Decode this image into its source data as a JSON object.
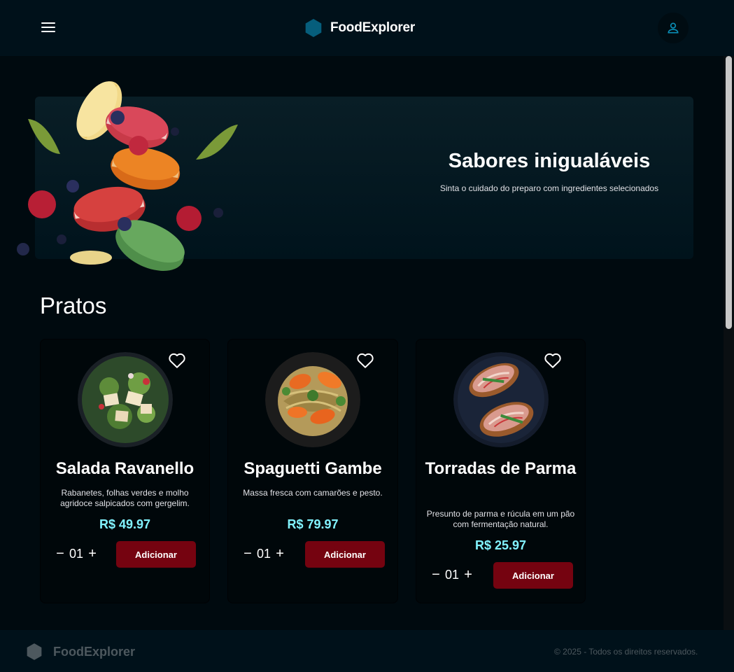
{
  "header": {
    "title": "FoodExplorer",
    "logo_icon": "hexagon-icon",
    "menu_icon": "hamburger-menu-icon",
    "user_icon": "user-icon",
    "accent_color": "#065e7c"
  },
  "banner": {
    "title": "Sabores inigualáveis",
    "subtitle": "Sinta o cuidado do preparo com ingredientes selecionados"
  },
  "section": {
    "title": "Pratos"
  },
  "dishes": [
    {
      "name": "Salada Ravanello",
      "description": "Rabanetes, folhas verdes e molho agridoce salpicados com gergelim.",
      "price": "R$ 49.97",
      "quantity": "01",
      "add_label": "Adicionar",
      "favorite_icon": "heart-outline-icon"
    },
    {
      "name": "Spaguetti Gambe",
      "description": "Massa fresca com camarões e pesto.",
      "price": "R$ 79.97",
      "quantity": "01",
      "add_label": "Adicionar",
      "favorite_icon": "heart-outline-icon"
    },
    {
      "name": "Torradas de Parma",
      "description": "Presunto de parma e rúcula em um pão com fermentação natural.",
      "price": "R$ 25.97",
      "quantity": "01",
      "add_label": "Adicionar",
      "favorite_icon": "heart-outline-icon"
    }
  ],
  "stepper": {
    "minus": "−",
    "plus": "+"
  },
  "footer": {
    "title": "FoodExplorer",
    "copyright": "© 2025 - Todos os direitos reservados."
  },
  "colors": {
    "background": "#000a0f",
    "price": "#82f3ff",
    "button": "#750310"
  }
}
